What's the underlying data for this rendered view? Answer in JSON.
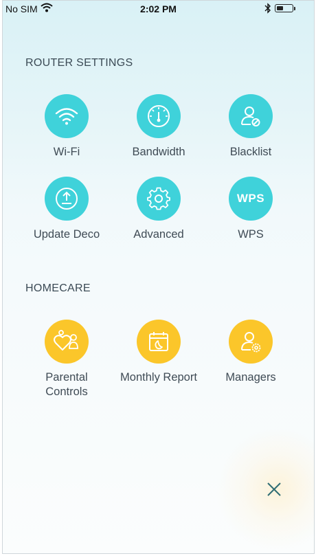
{
  "status_bar": {
    "carrier": "No SIM",
    "time": "2:02 PM"
  },
  "router_settings": {
    "title": "ROUTER SETTINGS",
    "items": [
      {
        "label": "Wi-Fi",
        "icon": "wifi-icon"
      },
      {
        "label": "Bandwidth",
        "icon": "speedometer-icon"
      },
      {
        "label": "Blacklist",
        "icon": "user-blocked-icon"
      },
      {
        "label": "Update Deco",
        "icon": "upload-icon"
      },
      {
        "label": "Advanced",
        "icon": "gear-icon"
      },
      {
        "label": "WPS",
        "icon": "wps-icon",
        "icon_text": "WPS"
      }
    ]
  },
  "homecare": {
    "title": "HOMECARE",
    "items": [
      {
        "label": "Parental Controls",
        "icon": "parental-icon"
      },
      {
        "label": "Monthly Report",
        "icon": "calendar-report-icon"
      },
      {
        "label": "Managers",
        "icon": "user-gear-icon"
      }
    ]
  },
  "colors": {
    "teal": "#3fd2da",
    "yellow": "#fbc62a",
    "text": "#3f4b55",
    "close": "#2f6d74"
  }
}
